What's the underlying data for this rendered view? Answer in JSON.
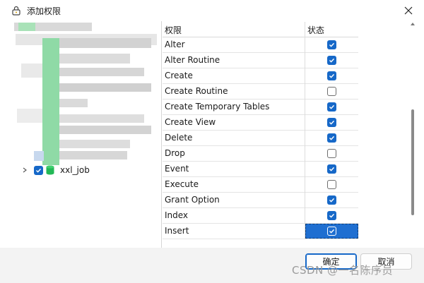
{
  "window": {
    "title": "添加权限",
    "close_icon": "close-icon"
  },
  "tree": {
    "items": [
      {
        "label": "xxl_job",
        "checked": true,
        "icon": "database-icon"
      }
    ]
  },
  "grid": {
    "columns": [
      "权限",
      "状态"
    ],
    "rows": [
      {
        "name": "Alter",
        "checked": true
      },
      {
        "name": "Alter Routine",
        "checked": true
      },
      {
        "name": "Create",
        "checked": true
      },
      {
        "name": "Create Routine",
        "checked": false
      },
      {
        "name": "Create Temporary Tables",
        "checked": true
      },
      {
        "name": "Create View",
        "checked": true
      },
      {
        "name": "Delete",
        "checked": true
      },
      {
        "name": "Drop",
        "checked": false
      },
      {
        "name": "Event",
        "checked": true
      },
      {
        "name": "Execute",
        "checked": false
      },
      {
        "name": "Grant Option",
        "checked": true
      },
      {
        "name": "Index",
        "checked": true
      },
      {
        "name": "Insert",
        "checked": true,
        "selected": true
      }
    ]
  },
  "footer": {
    "ok_label": "确定",
    "cancel_label": "取消"
  },
  "watermark": "CSDN @一名陈序员",
  "colors": {
    "accent": "#1668c8",
    "selection": "#1f6fd1"
  }
}
